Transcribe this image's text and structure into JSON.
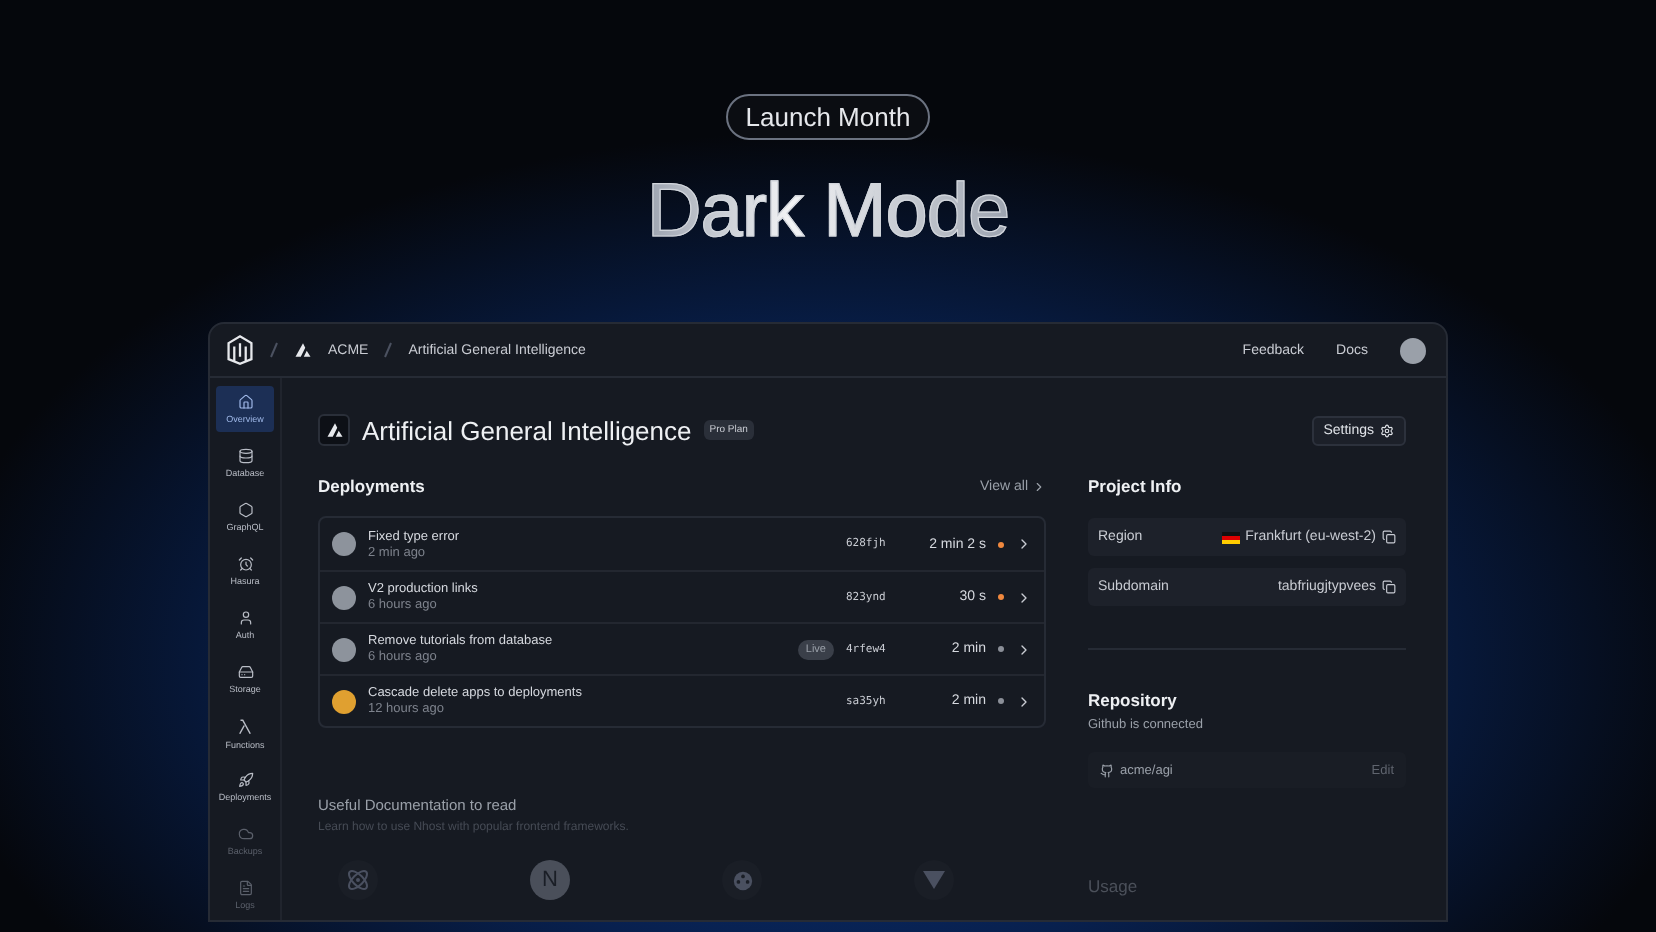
{
  "hero": {
    "badge": "Launch Month",
    "title": "Dark Mode"
  },
  "topbar": {
    "breadcrumbs": [
      "ACME",
      "Artificial General Intelligence"
    ],
    "links": [
      "Feedback",
      "Docs"
    ]
  },
  "sidebar": {
    "items": [
      {
        "label": "Overview",
        "kind": "home",
        "selected": true
      },
      {
        "label": "Database",
        "kind": "database",
        "selected": false
      },
      {
        "label": "GraphQL",
        "kind": "graphql",
        "selected": false
      },
      {
        "label": "Hasura",
        "kind": "hasura",
        "selected": false
      },
      {
        "label": "Auth",
        "kind": "auth",
        "selected": false
      },
      {
        "label": "Storage",
        "kind": "storage",
        "selected": false
      },
      {
        "label": "Functions",
        "kind": "functions",
        "selected": false
      },
      {
        "label": "Deployments",
        "kind": "deployments",
        "selected": false
      },
      {
        "label": "Backups",
        "kind": "backups",
        "selected": false
      },
      {
        "label": "Logs",
        "kind": "logs",
        "selected": false
      }
    ]
  },
  "project": {
    "name": "Artificial General Intelligence",
    "plan": "Pro Plan",
    "settings": "Settings"
  },
  "deployments": {
    "title": "Deployments",
    "view_all": "View all",
    "rows": [
      {
        "message": "Fixed type error",
        "time": "2 min ago",
        "commit": "628fjh",
        "duration": "2 min 2 s",
        "color": "#f0883e"
      },
      {
        "message": "V2 production links",
        "time": "6 hours ago",
        "commit": "823ynd",
        "duration": "30 s",
        "color": "#f0883e"
      },
      {
        "message": "Remove tutorials from database",
        "time": "6 hours ago",
        "badge": "Live",
        "commit": "4rfew4",
        "duration": "2 min",
        "color": "#8b8f98"
      },
      {
        "message": "Cascade delete apps to deployments",
        "time": "12 hours ago",
        "commit": "sa35yh",
        "duration": "2 min",
        "color": "#8b8f98"
      }
    ]
  },
  "docs": {
    "title": "Useful Documentation to read",
    "subtitle": "Learn how to use Nhost with popular frontend frameworks.",
    "frameworks": [
      {
        "kind": "react"
      },
      {
        "kind": "next",
        "glyph": "N"
      },
      {
        "kind": "svelte"
      },
      {
        "kind": "vue"
      }
    ]
  },
  "project_info": {
    "title": "Project Info",
    "rows": [
      {
        "label": "Region",
        "value": "Frankfurt (eu-west-2)",
        "flag": true
      },
      {
        "label": "Subdomain",
        "value": "tabfriugjtypvees",
        "flag": false
      }
    ]
  },
  "repository": {
    "title": "Repository",
    "subtitle": "Github is connected",
    "repo": "acme/agi",
    "action": "Edit"
  },
  "usage": {
    "title": "Usage"
  }
}
